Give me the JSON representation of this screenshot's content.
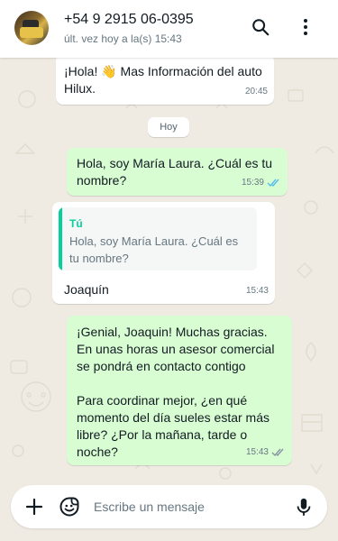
{
  "header": {
    "contact_name": "+54 9 2915 06-0395",
    "status": "últ. vez hoy a la(s) 15:43"
  },
  "messages": [
    {
      "direction": "incoming",
      "text": "¡Hola! 👋 Mas Información del auto Hilux.",
      "time": "20:45"
    },
    {
      "direction": "outgoing",
      "text": "Hola, soy María Laura. ¿Cuál es tu nombre?",
      "time": "15:39",
      "read": true
    },
    {
      "direction": "incoming",
      "quote_author": "Tú",
      "quote_text": "Hola, soy María Laura. ¿Cuál es tu nombre?",
      "text": "Joaquín",
      "time": "15:43"
    },
    {
      "direction": "outgoing",
      "text": "¡Genial, Joaquin! Muchas gracias. En unas horas un asesor comercial se pondrá en contacto contigo\n\nPara coordinar mejor, ¿en qué momento del día sueles estar más libre? ¿Por la mañana, tarde o noche?",
      "time": "15:43",
      "read": false
    }
  ],
  "date_separator": "Hoy",
  "composer": {
    "placeholder": "Escribe un mensaje"
  },
  "colors": {
    "outgoing_bubble": "#d9fdd3",
    "incoming_bubble": "#ffffff",
    "quote_accent": "#06cf9c",
    "read_ticks": "#53bdeb",
    "chat_background": "#efeae2"
  },
  "icons": [
    "search-icon",
    "more-vert-icon",
    "plus-icon",
    "sticker-icon",
    "mic-icon",
    "double-check-icon"
  ]
}
